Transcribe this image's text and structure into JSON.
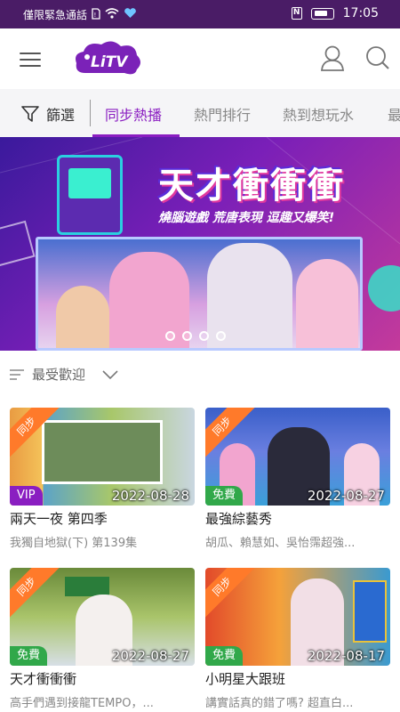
{
  "status_bar": {
    "carrier": "僅限緊急通話",
    "time": "17:05",
    "icons": [
      "sim-icon",
      "wifi-icon",
      "heart-icon",
      "nfc-icon",
      "battery-icon"
    ]
  },
  "header": {
    "logo_text": "LiTV",
    "brand_color": "#7b22b8",
    "icons": [
      "menu-icon",
      "user-icon",
      "search-icon"
    ]
  },
  "tabs": {
    "filter_label": "篩選",
    "items": [
      {
        "label": "同步熱播",
        "active": true
      },
      {
        "label": "熱門排行",
        "active": false
      },
      {
        "label": "熱到想玩水",
        "active": false
      },
      {
        "label": "最",
        "active": false
      }
    ],
    "accent": "#8a1ec1"
  },
  "banner": {
    "title": "天才衝衝衝",
    "subtitle": "燒腦遊戲 荒唐表現 逗趣又爆笑!",
    "page_count": 4
  },
  "sort": {
    "label": "最受歡迎"
  },
  "cards": [
    {
      "ribbon": "同步",
      "badge": "VIP",
      "badge_type": "vip",
      "date": "2022-08-28",
      "title": "兩天一夜 第四季",
      "subtitle": "我獨自地獄(下) 第139集"
    },
    {
      "ribbon": "同步",
      "badge": "免費",
      "badge_type": "free",
      "date": "2022-08-27",
      "title": "最強綜藝秀",
      "subtitle": "胡瓜、賴慧如、吳怡霈超強..."
    },
    {
      "ribbon": "同步",
      "badge": "免費",
      "badge_type": "free",
      "date": "2022-08-27",
      "title": "天才衝衝衝",
      "subtitle": "高手們遇到接龍TEMPO，..."
    },
    {
      "ribbon": "同步",
      "badge": "免費",
      "badge_type": "free",
      "date": "2022-08-17",
      "title": "小明星大跟班",
      "subtitle": "講實話真的錯了嗎? 超直白..."
    }
  ]
}
